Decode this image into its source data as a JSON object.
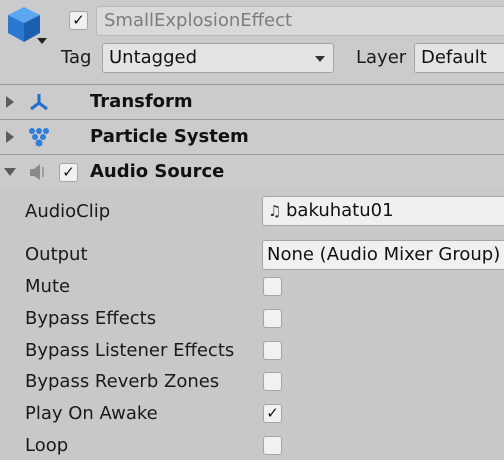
{
  "header": {
    "object_name": "SmallExplosionEffect",
    "active_checked": true,
    "tag_label": "Tag",
    "tag_value": "Untagged",
    "layer_label": "Layer",
    "layer_value": "Default"
  },
  "components": [
    {
      "name": "Transform",
      "icon": "transform-icon",
      "expanded": false
    },
    {
      "name": "Particle System",
      "icon": "particle-system-icon",
      "expanded": false
    },
    {
      "name": "Audio Source",
      "icon": "audio-source-icon",
      "expanded": true,
      "enabled": true
    }
  ],
  "audio_source": {
    "audioclip_label": "AudioClip",
    "audioclip_value": "bakuhatu01",
    "output_label": "Output",
    "output_value": "None (Audio Mixer Group)",
    "checks": [
      {
        "label": "Mute",
        "checked": false
      },
      {
        "label": "Bypass Effects",
        "checked": false
      },
      {
        "label": "Bypass Listener Effects",
        "checked": false
      },
      {
        "label": "Bypass Reverb Zones",
        "checked": false
      },
      {
        "label": "Play On Awake",
        "checked": true
      },
      {
        "label": "Loop",
        "checked": false
      }
    ]
  },
  "colors": {
    "accent_blue": "#2e7fd9",
    "panel_bg": "#c8c8c8",
    "header_bg": "#cbcbcb"
  }
}
